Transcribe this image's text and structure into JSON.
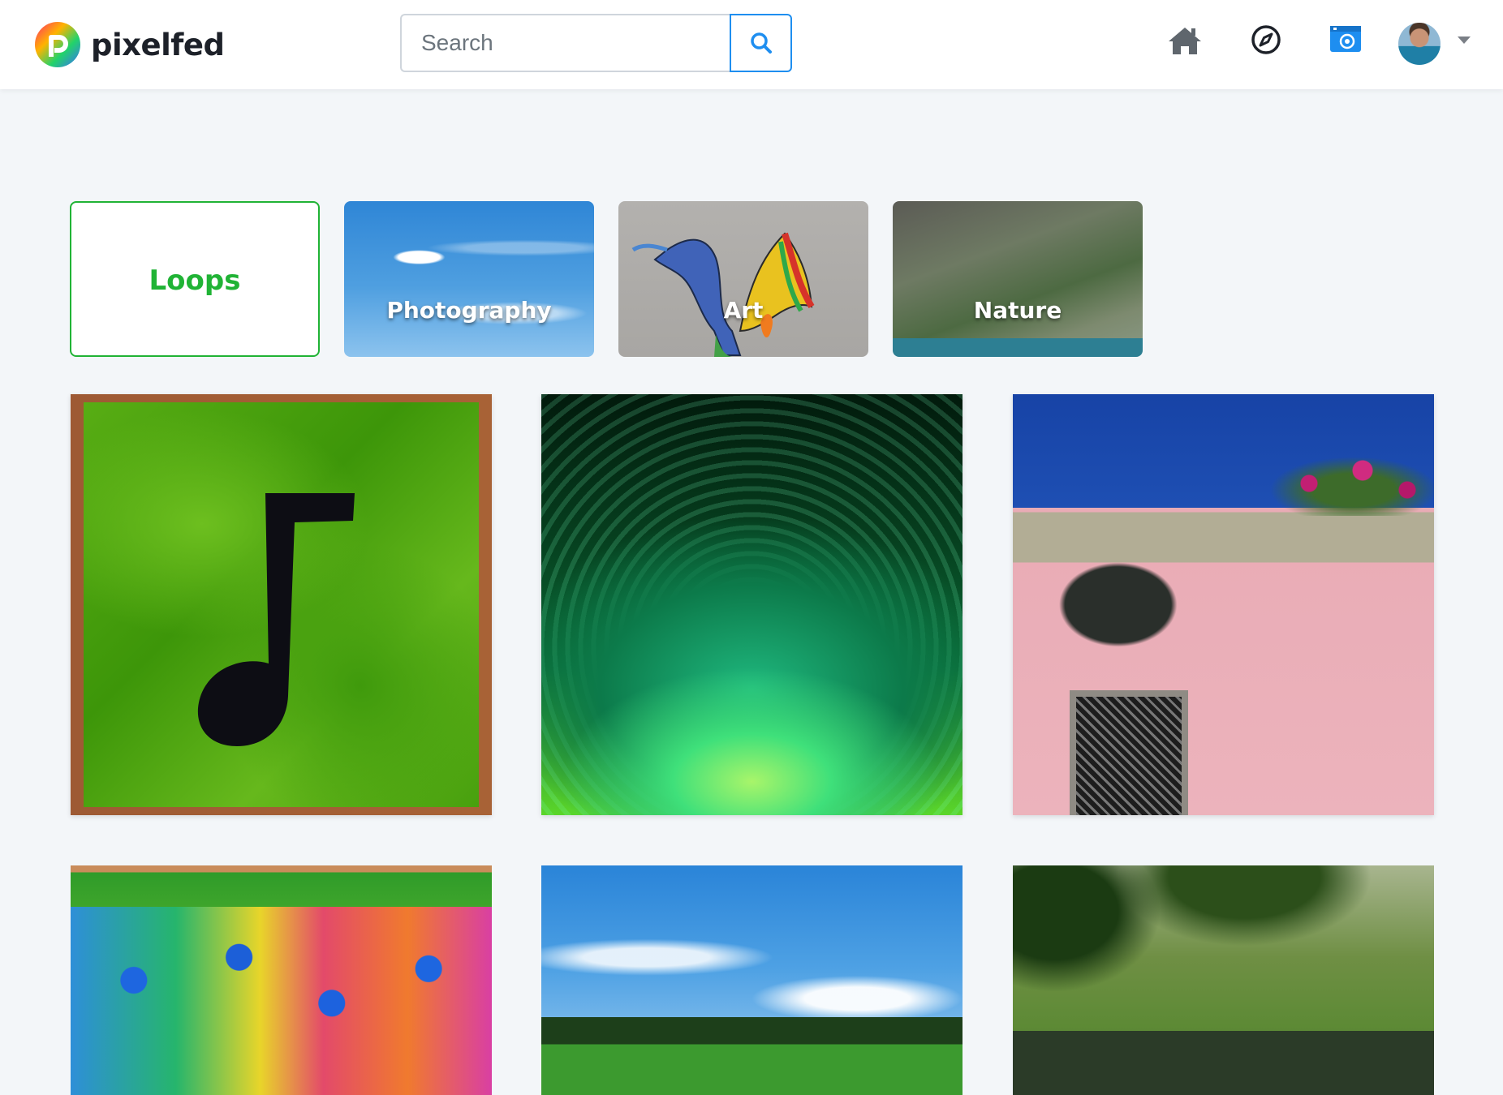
{
  "app": {
    "brand_name": "pixelfed"
  },
  "header": {
    "search": {
      "placeholder": "Search"
    },
    "nav_icons": [
      "home-icon",
      "compass-icon",
      "camera-icon"
    ],
    "accent_color": "#1e8ef0"
  },
  "categories": [
    {
      "label": "Loops",
      "color": "#20b335"
    },
    {
      "label": "Photography"
    },
    {
      "label": "Art"
    },
    {
      "label": "Nature"
    }
  ]
}
